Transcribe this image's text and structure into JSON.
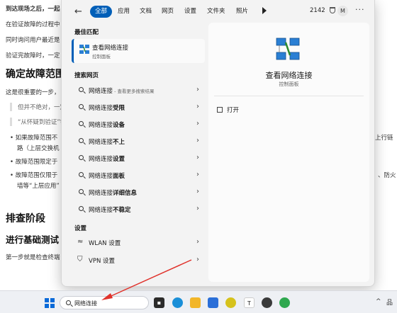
{
  "document": {
    "line1": "到达现场之后，一起",
    "line2": "在验证故障的过程中",
    "line3": "同时询问用户最近是",
    "line4": "验证完故障时，一定",
    "heading1": "确定故障范围",
    "line5": "这是很重要的一步，",
    "quote1": "但并不绝对，一定",
    "quote2": "“从怀疑到验证”需",
    "bullet1a": "如果故障范围不",
    "bullet1b": "路（上层交换机",
    "bullet2": "故障范围限定于",
    "bullet3a": "故障范围仅限于",
    "bullet3b": "墙等“上层应用”",
    "right1": "上行链",
    "right2": "、防火",
    "heading2": "排查阶段",
    "heading3": "进行基础测试",
    "line6": "第一步就是检查终端"
  },
  "filters": {
    "back": "←",
    "chips": [
      "全部",
      "应用",
      "文档",
      "网页",
      "设置",
      "文件夹",
      "照片"
    ],
    "points": "2142",
    "avatar": "M",
    "more": "···"
  },
  "left": {
    "best_match_label": "最佳匹配",
    "best_title": "查看网络连接",
    "best_sub": "控制面板",
    "web_label": "搜索网页",
    "web_items": [
      {
        "prefix": "网络连接",
        "bold": "",
        "hint": " - 查看更多搜索结果"
      },
      {
        "prefix": "网络连接",
        "bold": "受限",
        "hint": ""
      },
      {
        "prefix": "网络连接",
        "bold": "设备",
        "hint": ""
      },
      {
        "prefix": "网络连接",
        "bold": "不上",
        "hint": ""
      },
      {
        "prefix": "网络连接",
        "bold": "设置",
        "hint": ""
      },
      {
        "prefix": "网络连接",
        "bold": "面板",
        "hint": ""
      },
      {
        "prefix": "网络连接",
        "bold": "详细信息",
        "hint": ""
      },
      {
        "prefix": "网络连接",
        "bold": "不稳定",
        "hint": ""
      }
    ],
    "settings_label": "设置",
    "settings_items": [
      {
        "label": "WLAN 设置"
      },
      {
        "label": "VPN 设置"
      }
    ]
  },
  "right": {
    "title": "查看网络连接",
    "sub": "控制面板",
    "open_label": "打开"
  },
  "taskbar": {
    "search_value": "网络连接",
    "tray_chev": "^",
    "tray_misc": "品"
  },
  "colors": {
    "accent": "#005fb8",
    "annotation": "#e0322b"
  }
}
